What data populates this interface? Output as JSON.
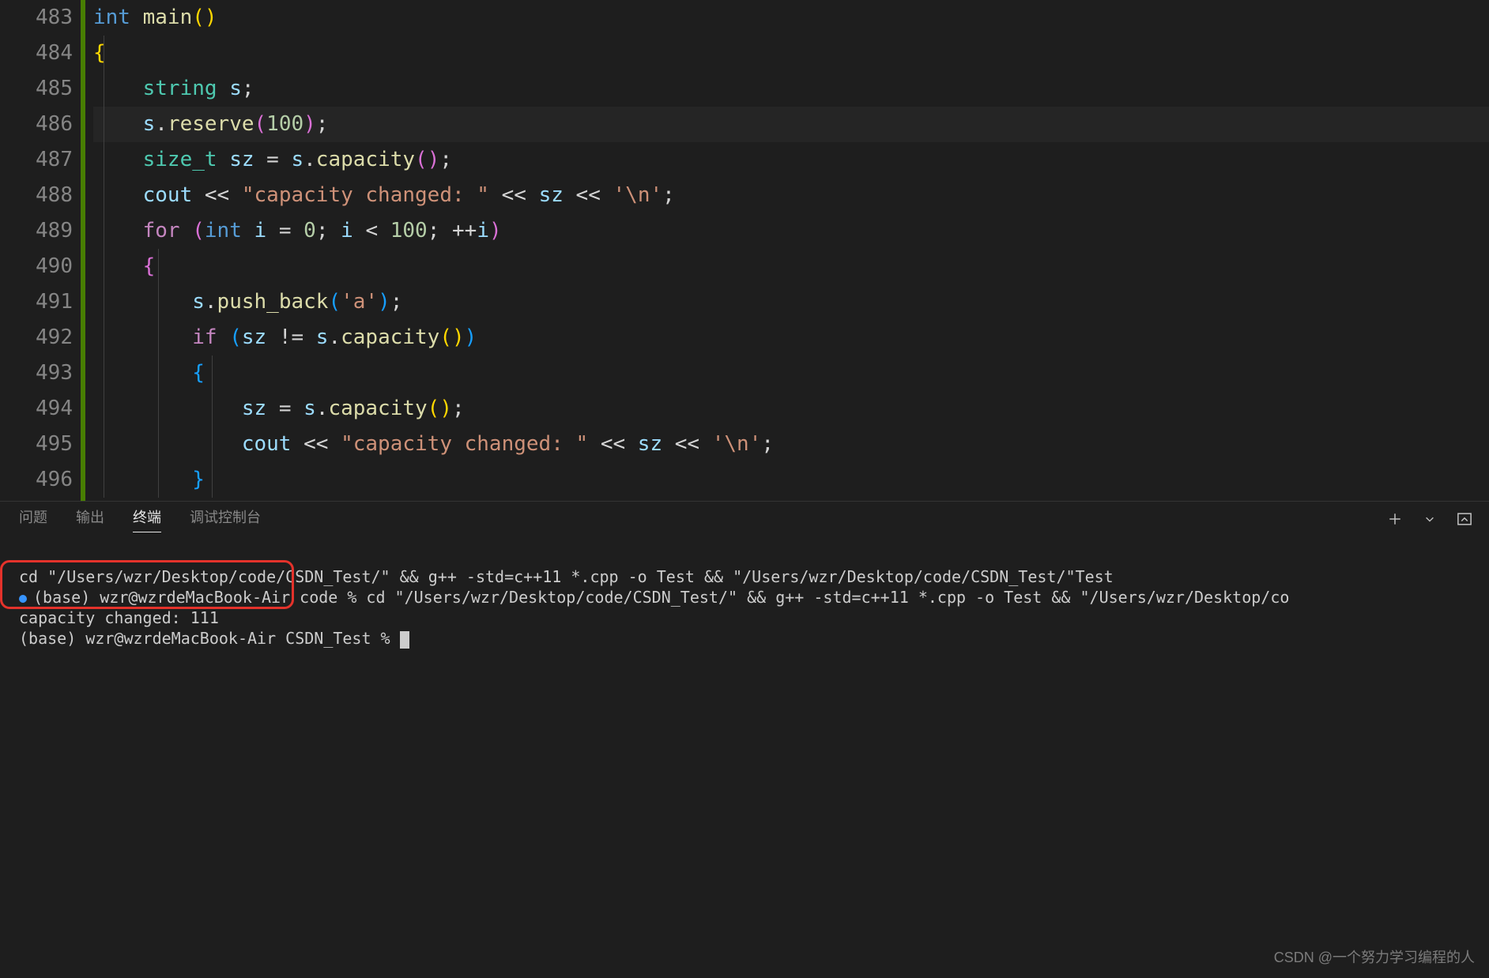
{
  "editor": {
    "line_numbers": [
      "483",
      "484",
      "485",
      "486",
      "487",
      "488",
      "489",
      "490",
      "491",
      "492",
      "493",
      "494",
      "495",
      "496"
    ],
    "highlighted_line_index": 3,
    "code": {
      "l0": {
        "kw_int": "int",
        "fn_main": "main"
      },
      "l2": {
        "ty_string": "string",
        "var_s": "s"
      },
      "l3": {
        "var_s": "s",
        "fn_reserve": "reserve",
        "num_100": "100"
      },
      "l4": {
        "ty_size_t": "size_t",
        "var_sz": "sz",
        "var_s": "s",
        "fn_capacity": "capacity"
      },
      "l5": {
        "var_cout": "cout",
        "str_cap": "\"capacity changed: \"",
        "var_sz": "sz",
        "str_nl": "'\\n'"
      },
      "l6": {
        "ctrl_for": "for",
        "kw_int": "int",
        "var_i": "i",
        "num_0": "0",
        "num_100": "100"
      },
      "l8": {
        "var_s": "s",
        "fn_push_back": "push_back",
        "str_a": "'a'"
      },
      "l9": {
        "ctrl_if": "if",
        "var_sz": "sz",
        "var_s": "s",
        "fn_capacity": "capacity"
      },
      "l11": {
        "var_sz": "sz",
        "var_s": "s",
        "fn_capacity": "capacity"
      },
      "l12": {
        "var_cout": "cout",
        "str_cap": "\"capacity changed: \"",
        "var_sz": "sz",
        "str_nl": "'\\n'"
      }
    }
  },
  "panel": {
    "tabs": {
      "problems": "问题",
      "output": "输出",
      "terminal": "终端",
      "debug": "调试控制台"
    },
    "active_tab": "terminal"
  },
  "terminal": {
    "line1": "cd \"/Users/wzr/Desktop/code/CSDN_Test/\" && g++ -std=c++11 *.cpp -o Test && \"/Users/wzr/Desktop/code/CSDN_Test/\"Test",
    "line2": "(base) wzr@wzrdeMacBook-Air code % cd \"/Users/wzr/Desktop/code/CSDN_Test/\" && g++ -std=c++11 *.cpp -o Test && \"/Users/wzr/Desktop/co",
    "line3": "capacity changed: 111",
    "line4": "(base) wzr@wzrdeMacBook-Air CSDN_Test % "
  },
  "watermark": "CSDN @一个努力学习编程的人"
}
